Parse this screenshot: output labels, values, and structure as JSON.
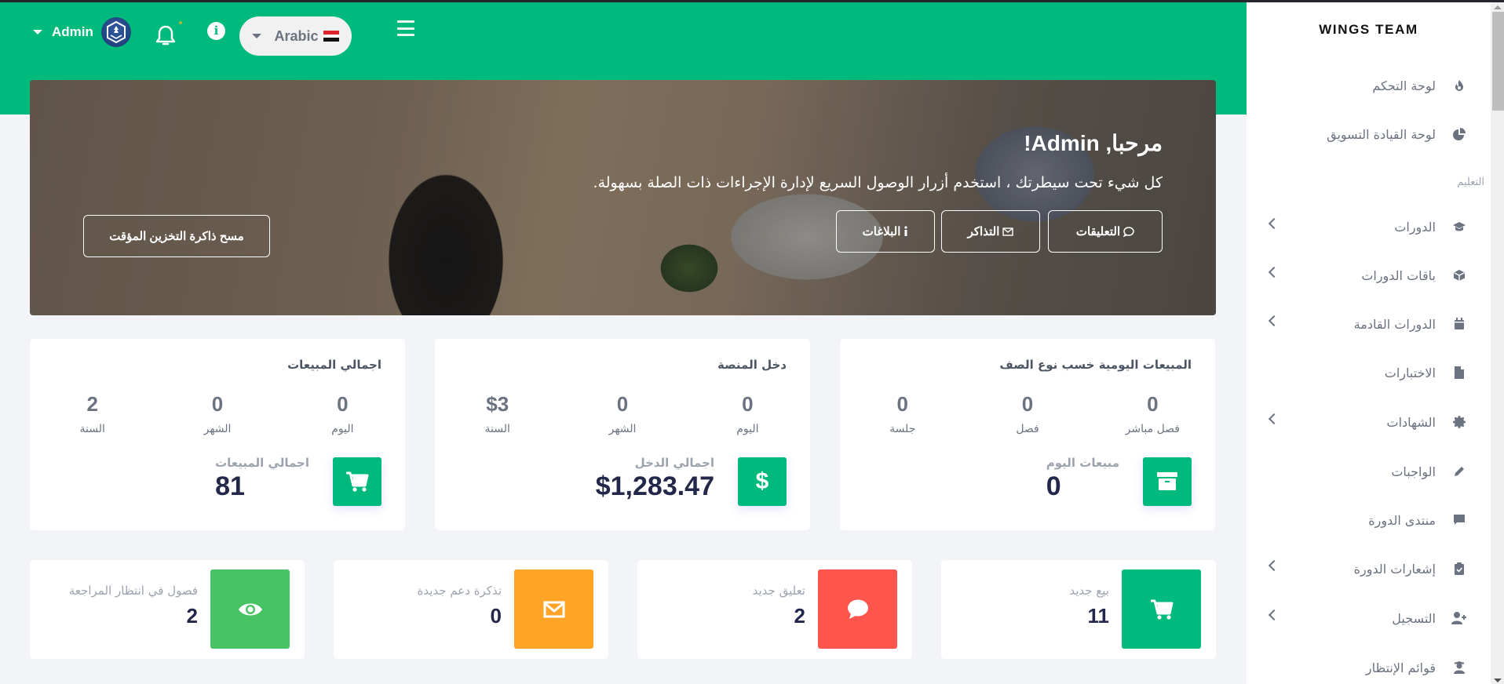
{
  "header": {
    "user_name": "Admin",
    "language_label": "Arabic",
    "icons": {
      "user_caret": "caret-down-icon",
      "avatar": "avatar",
      "notifications": "bell-icon",
      "info": "info-icon",
      "language_flag": "egypt-flag-icon",
      "menu": "hamburger-icon"
    },
    "info_glyph": "i"
  },
  "banner": {
    "welcome": "مرحبا, Admin!",
    "subtitle": "كل شيء تحت سيطرتك ، استخدم أزرار الوصول السريع لإدارة الإجراءات ذات الصلة بسهولة.",
    "buttons": {
      "comments": "التعليقات",
      "tickets": "التذاكر",
      "reports": "البلاغات",
      "clear_cache": "مسح ذاكرة التخزين المؤقت"
    }
  },
  "stat_cards": [
    {
      "title": "المبيعات اليومية خسب نوع الصف",
      "cells": [
        {
          "value": "0",
          "label": "فصل مباشر"
        },
        {
          "value": "0",
          "label": "فصل"
        },
        {
          "value": "0",
          "label": "جلسة"
        }
      ],
      "summary_label": "مبيعات اليوم",
      "summary_value": "0",
      "icon": "archive-icon"
    },
    {
      "title": "دخل المنصة",
      "cells": [
        {
          "value": "0",
          "label": "اليوم"
        },
        {
          "value": "0",
          "label": "الشهر"
        },
        {
          "value": "$3",
          "label": "السنة"
        }
      ],
      "summary_label": "اجمالي الدخل",
      "summary_value": "$1,283.47",
      "icon": "dollar-icon"
    },
    {
      "title": "اجمالي المبيعات",
      "cells": [
        {
          "value": "0",
          "label": "اليوم"
        },
        {
          "value": "0",
          "label": "الشهر"
        },
        {
          "value": "2",
          "label": "السنة"
        }
      ],
      "summary_label": "اجمالي المبيعات",
      "summary_value": "81",
      "icon": "cart-icon"
    }
  ],
  "mini_cards": [
    {
      "label": "بيع جديد",
      "value": "11",
      "icon": "cart-icon",
      "color": "#00b97c"
    },
    {
      "label": "تعليق جديد",
      "value": "2",
      "icon": "comment-icon",
      "color": "#ff554c"
    },
    {
      "label": "تذكرة دعم جديدة",
      "value": "0",
      "icon": "envelope-icon",
      "color": "#ffa426"
    },
    {
      "label": "فصول في انتظار المراجعة",
      "value": "2",
      "icon": "eye-icon",
      "color": "#47c363"
    }
  ],
  "sidebar": {
    "brand": "WINGS TEAM",
    "section_label": "التعليم",
    "items": [
      {
        "label": "لوحة التحكم",
        "icon": "fire-icon",
        "has_submenu": false
      },
      {
        "label": "لوحة القيادة التسويق",
        "icon": "chart-pie-icon",
        "has_submenu": false
      },
      {
        "label": "الدورات",
        "icon": "graduation-cap-icon",
        "has_submenu": true
      },
      {
        "label": "باقات الدورات",
        "icon": "box-icon",
        "has_submenu": true
      },
      {
        "label": "الدورات القادمة",
        "icon": "calendar-icon",
        "has_submenu": true
      },
      {
        "label": "الاختبارات",
        "icon": "file-icon",
        "has_submenu": false
      },
      {
        "label": "الشهادات",
        "icon": "certificate-icon",
        "has_submenu": true
      },
      {
        "label": "الواجبات",
        "icon": "pencil-icon",
        "has_submenu": false
      },
      {
        "label": "منتدى الدورة",
        "icon": "comment-alt-icon",
        "has_submenu": false
      },
      {
        "label": "إشعارات الدورة",
        "icon": "clipboard-check-icon",
        "has_submenu": true
      },
      {
        "label": "التسجيل",
        "icon": "user-plus-icon",
        "has_submenu": true
      },
      {
        "label": "قوائم الإنتظار",
        "icon": "user-graduate-icon",
        "has_submenu": false
      }
    ]
  },
  "colors": {
    "primary": "#00b97c",
    "danger": "#ff554c",
    "warning": "#ffa426",
    "success": "#47c363",
    "text_dark": "#23284a"
  }
}
